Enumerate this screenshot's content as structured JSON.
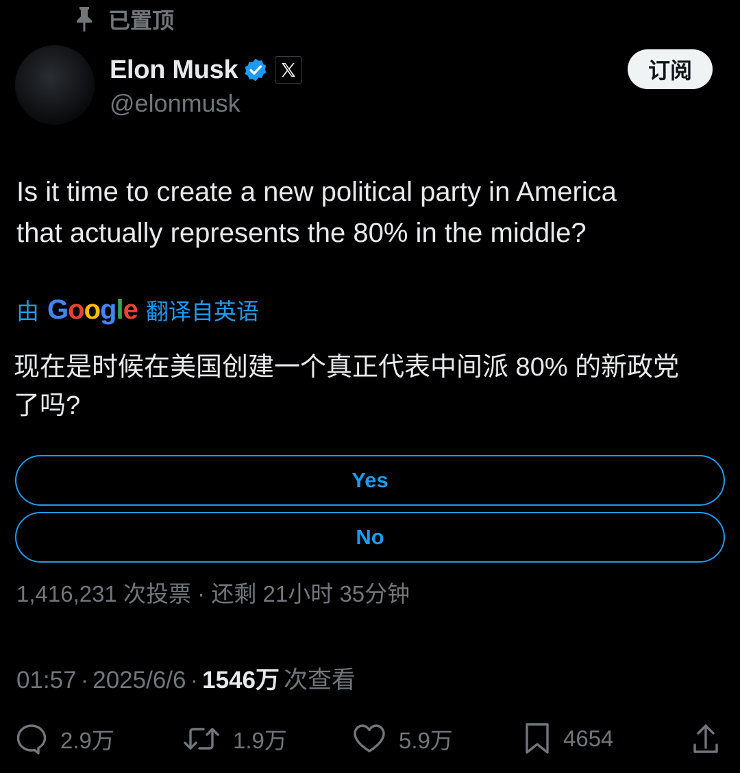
{
  "pinned": {
    "label": "已置顶"
  },
  "author": {
    "name": "Elon Musk",
    "handle": "@elonmusk"
  },
  "subscribe_button": "订阅",
  "tweet": {
    "text_line1": "Is it time to create a new political party in America",
    "text_line2": "that actually represents the 80% in the middle?"
  },
  "translation": {
    "prefix": "由",
    "provider_logo_text": "Google",
    "suffix": "翻译自英语",
    "text_line1": "现在是时候在美国创建一个真正代表中间派 80% 的新政党",
    "text_line2": "了吗?"
  },
  "poll": {
    "options": [
      "Yes",
      "No"
    ],
    "votes": "1,416,231 次投票",
    "separator": "·",
    "time_left": "还剩 21小时 35分钟"
  },
  "meta": {
    "time": "01:57",
    "sep1": "·",
    "date": "2025/6/6",
    "sep2": "·",
    "views_count": "1546万",
    "views_label": "次查看"
  },
  "actions": {
    "replies": "2.9万",
    "reposts": "1.9万",
    "likes": "5.9万",
    "bookmarks": "4654"
  },
  "colors": {
    "background": "#000000",
    "text_primary": "#e7e9ea",
    "text_secondary": "#71767b",
    "accent_blue": "#1d9bf0",
    "button_light": "#eff3f4"
  },
  "icons": [
    "pin-icon",
    "verified-badge-icon",
    "x-logo-icon",
    "reply-icon",
    "repost-icon",
    "like-icon",
    "bookmark-icon",
    "share-icon"
  ]
}
